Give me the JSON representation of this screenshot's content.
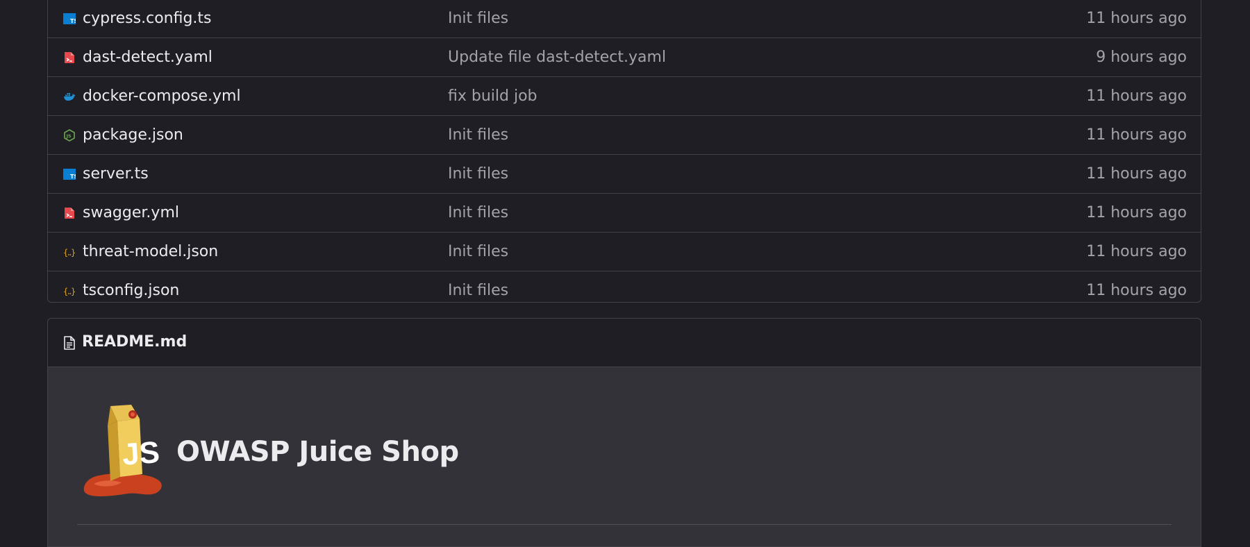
{
  "files": [
    {
      "name": "cypress.config.ts",
      "icon": "typescript-icon",
      "commit": "Init files",
      "time": "11 hours ago"
    },
    {
      "name": "dast-detect.yaml",
      "icon": "yaml-icon",
      "commit": "Update file dast-detect.yaml",
      "time": "9 hours ago"
    },
    {
      "name": "docker-compose.yml",
      "icon": "docker-icon",
      "commit": "fix build job",
      "time": "11 hours ago"
    },
    {
      "name": "package.json",
      "icon": "nodejs-icon",
      "commit": "Init files",
      "time": "11 hours ago"
    },
    {
      "name": "server.ts",
      "icon": "typescript-icon",
      "commit": "Init files",
      "time": "11 hours ago"
    },
    {
      "name": "swagger.yml",
      "icon": "yaml-icon",
      "commit": "Init files",
      "time": "11 hours ago"
    },
    {
      "name": "threat-model.json",
      "icon": "json-icon",
      "commit": "Init files",
      "time": "11 hours ago"
    },
    {
      "name": "tsconfig.json",
      "icon": "json-icon",
      "commit": "Init files",
      "time": "11 hours ago"
    }
  ],
  "readme": {
    "filename": "README.md",
    "heading": "OWASP Juice Shop",
    "logo_icon": "juice-shop-logo",
    "logo_text": "JS"
  },
  "colors": {
    "background": "#1f1e24",
    "readme_body": "#333238",
    "border": "#434248",
    "text": "#ececef",
    "muted_text": "#a4a3a8",
    "typescript": "#0a7fd1",
    "yaml": "#e5484d",
    "docker": "#1f8fd6",
    "nodejs": "#6aa84f",
    "json": "#e0a31a"
  }
}
